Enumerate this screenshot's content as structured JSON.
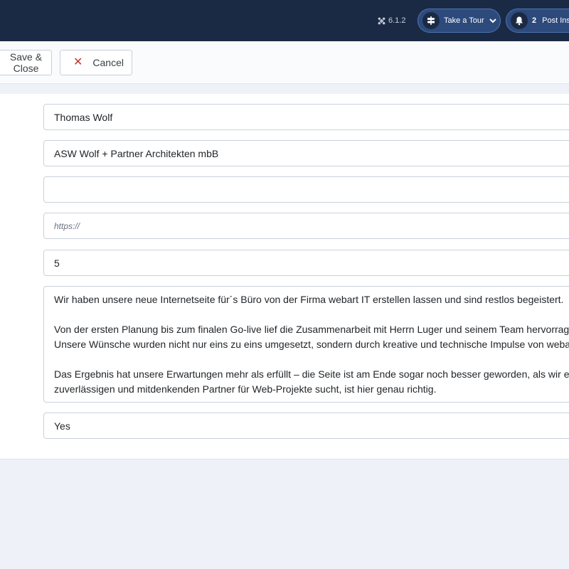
{
  "header": {
    "version": "6.1.2",
    "tour_label": "Take a Tour",
    "notification_count": "2",
    "post_label": "Post Installation Messages"
  },
  "toolbar": {
    "save_close_label": "Save & Close",
    "cancel_label": "Cancel"
  },
  "form": {
    "name": "Thomas Wolf",
    "company": "ASW Wolf + Partner Architekten mbB",
    "email": "",
    "website_placeholder": "https://",
    "rating": "5",
    "review": "Wir haben unsere neue Internetseite für´s Büro von der Firma webart IT erstellen lassen und sind restlos begeistert.\n\nVon der ersten Planung bis zum finalen Go-live lief die Zusammenarbeit mit Herrn Luger und seinem Team hervorragend.\nUnsere Wünsche wurden nicht nur eins zu eins umgesetzt, sondern durch kreative und technische Impulse von webart IT bereichert.\n\nDas Ergebnis hat unsere Erwartungen mehr als erfüllt – die Seite ist am Ende sogar noch besser geworden, als wir erwartet hatten. Wer einen\nzuverlässigen und mitdenkenden Partner für Web-Projekte sucht, ist hier genau richtig.",
    "published": "Yes"
  },
  "colors": {
    "header_bg": "#1b2a44",
    "pill_bg": "#2d4a7c",
    "cancel_x": "#c0392b",
    "page_bg": "#eef2f8"
  },
  "icons": {
    "version": "joomla-icon",
    "tour": "signpost-icon",
    "tour_chevron": "chevron-down-icon",
    "notification": "bell-icon",
    "cancel": "close-icon"
  }
}
